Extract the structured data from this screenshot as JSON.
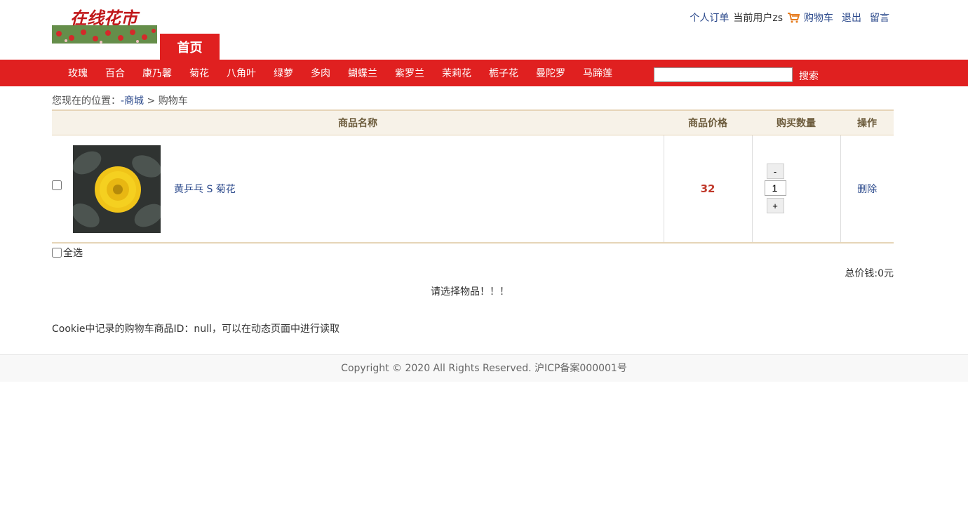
{
  "header": {
    "logo_text": "在线花市",
    "home_tab": "首页",
    "links": {
      "orders": "个人订单",
      "current_user": "当前用户zs",
      "cart": "购物车",
      "logout": "退出",
      "message": "留言"
    }
  },
  "nav": {
    "categories": [
      "玫瑰",
      "百合",
      "康乃馨",
      "菊花",
      "八角叶",
      "绿萝",
      "多肉",
      "蝴蝶兰",
      "紫罗兰",
      "茉莉花",
      "栀子花",
      "曼陀罗",
      "马蹄莲"
    ],
    "search_value": "",
    "search_label": "搜索"
  },
  "breadcrumb": {
    "prefix": "您现在的位置：",
    "link": "-商城",
    "sep": " > ",
    "current": "购物车"
  },
  "cart": {
    "columns": [
      "商品名称",
      "商品价格",
      "购买数量",
      "操作"
    ],
    "items": [
      {
        "name": "黄乒乓 S 菊花",
        "price": "32",
        "quantity": "1",
        "action": "删除"
      }
    ],
    "minus_label": "-",
    "plus_label": "+"
  },
  "select_all": "全选",
  "total": "总价钱:0元",
  "notice": "请选择物品！！！",
  "cookie_note": "Cookie中记录的购物车商品ID：null，可以在动态页面中进行读取",
  "footer": "Copyright © 2020 All Rights Reserved. 沪ICP备案000001号",
  "colors": {
    "brand_red": "#e02020",
    "price": "#c0392b",
    "link": "#2c4a8c"
  }
}
